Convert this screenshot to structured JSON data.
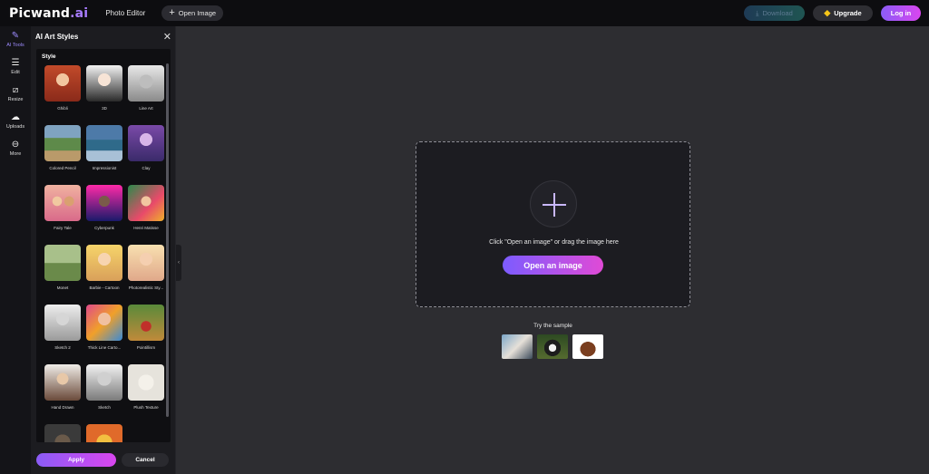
{
  "header": {
    "logo_main": "Picwand",
    "logo_suffix": ".ai",
    "title": "Photo Editor",
    "open_image": "Open Image",
    "download": "Download",
    "upgrade": "Upgrade",
    "login": "Log in"
  },
  "rail": [
    {
      "label": "AI Tools",
      "icon": "sparkle-pen-icon"
    },
    {
      "label": "Edit",
      "icon": "sliders-icon"
    },
    {
      "label": "Resize",
      "icon": "crop-icon"
    },
    {
      "label": "Uploads",
      "icon": "cloud-upload-icon"
    },
    {
      "label": "More",
      "icon": "more-circle-icon"
    }
  ],
  "panel": {
    "title": "AI Art Styles",
    "section_label": "Style",
    "styles": [
      "Ghibli",
      "3D",
      "Line Art",
      "Colored Pencil",
      "Impressionist",
      "Clay",
      "Fairy Tale",
      "Cyberpunk",
      "Henri Matisse",
      "Monet",
      "Barbie - Cartoon",
      "Photorealistic Sty...",
      "Sketch 2",
      "Thick Line Carto...",
      "Pointillism",
      "Hand Drawn",
      "Sketch",
      "Plush Texture",
      "",
      ""
    ],
    "apply": "Apply",
    "cancel": "Cancel"
  },
  "main": {
    "hint": "Click \"Open an image\" or drag the image here",
    "open_button": "Open an image",
    "sample_label": "Try the sample"
  },
  "colors": {
    "accent_start": "#7c5cff",
    "accent_end": "#e04ad6",
    "background": "#2d2d31",
    "topbar": "#0d0d10"
  }
}
